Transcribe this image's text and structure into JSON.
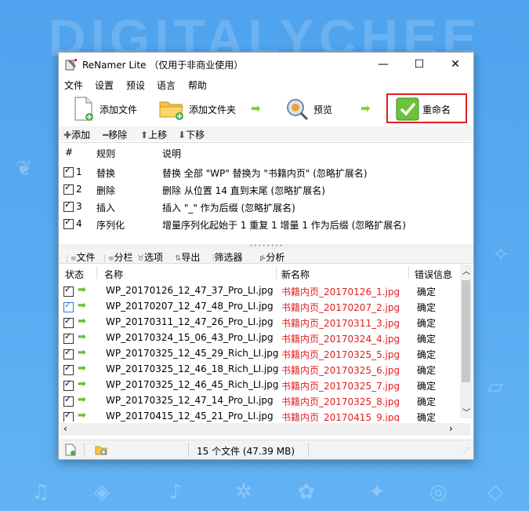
{
  "background": {
    "brand_text": "DIGITALYCHEE"
  },
  "window": {
    "title": "ReNamer Lite （仅用于非商业使用）",
    "controls": {
      "minimize": "—",
      "maximize": "☐",
      "close": "✕"
    }
  },
  "menu": [
    "文件",
    "设置",
    "预设",
    "语言",
    "帮助"
  ],
  "toolbar": {
    "add_files": "添加文件",
    "add_folder": "添加文件夹",
    "preview": "预览",
    "rename": "重命名"
  },
  "rules_toolbar": {
    "add": "添加",
    "remove": "移除",
    "up": "上移",
    "down": "下移"
  },
  "rules": {
    "headers": {
      "num": "#",
      "rule": "规则",
      "desc": "说明"
    },
    "rows": [
      {
        "num": "1",
        "rule": "替换",
        "desc": "替换 全部 \"WP\" 替换为 \"书籍内页\" (忽略扩展名)"
      },
      {
        "num": "2",
        "rule": "删除",
        "desc": "删除 从位置 14 直到末尾 (忽略扩展名)"
      },
      {
        "num": "3",
        "rule": "插入",
        "desc": "插入 \"_\" 作为后缀 (忽略扩展名)"
      },
      {
        "num": "4",
        "rule": "序列化",
        "desc": "增量序列化起始于 1 重复 1 增量 1 作为后缀 (忽略扩展名)"
      }
    ]
  },
  "files_toolbar": {
    "files": "文件",
    "columns": "分栏",
    "options": "选项",
    "export": "导出",
    "filter": "筛选器",
    "analyze": "分析"
  },
  "files": {
    "headers": {
      "state": "状态",
      "name": "名称",
      "new_name": "新名称",
      "error": "错误信息"
    },
    "rows": [
      {
        "name": "WP_20170126_12_47_37_Pro_LI.jpg",
        "new_name": "书籍内页_20170126_1.jpg",
        "error": "确定"
      },
      {
        "name": "WP_20170207_12_47_48_Pro_LI.jpg",
        "new_name": "书籍内页_20170207_2.jpg",
        "error": "确定"
      },
      {
        "name": "WP_20170311_12_47_26_Pro_LI.jpg",
        "new_name": "书籍内页_20170311_3.jpg",
        "error": "确定"
      },
      {
        "name": "WP_20170324_15_06_43_Pro_LI.jpg",
        "new_name": "书籍内页_20170324_4.jpg",
        "error": "确定"
      },
      {
        "name": "WP_20170325_12_45_29_Rich_LI.jpg",
        "new_name": "书籍内页_20170325_5.jpg",
        "error": "确定"
      },
      {
        "name": "WP_20170325_12_46_18_Rich_LI.jpg",
        "new_name": "书籍内页_20170325_6.jpg",
        "error": "确定"
      },
      {
        "name": "WP_20170325_12_46_45_Rich_LI.jpg",
        "new_name": "书籍内页_20170325_7.jpg",
        "error": "确定"
      },
      {
        "name": "WP_20170325_12_47_14_Pro_LI.jpg",
        "new_name": "书籍内页_20170325_8.jpg",
        "error": "确定"
      },
      {
        "name": "WP_20170415_12_45_21_Pro_LI.jpg",
        "new_name": "书籍内页_20170415_9.jpg",
        "error": "确定"
      }
    ]
  },
  "status": {
    "summary": "15 个文件 (47.39 MB)"
  },
  "colors": {
    "accent_red": "#e02020",
    "arrow_green": "#6ebe2a"
  }
}
